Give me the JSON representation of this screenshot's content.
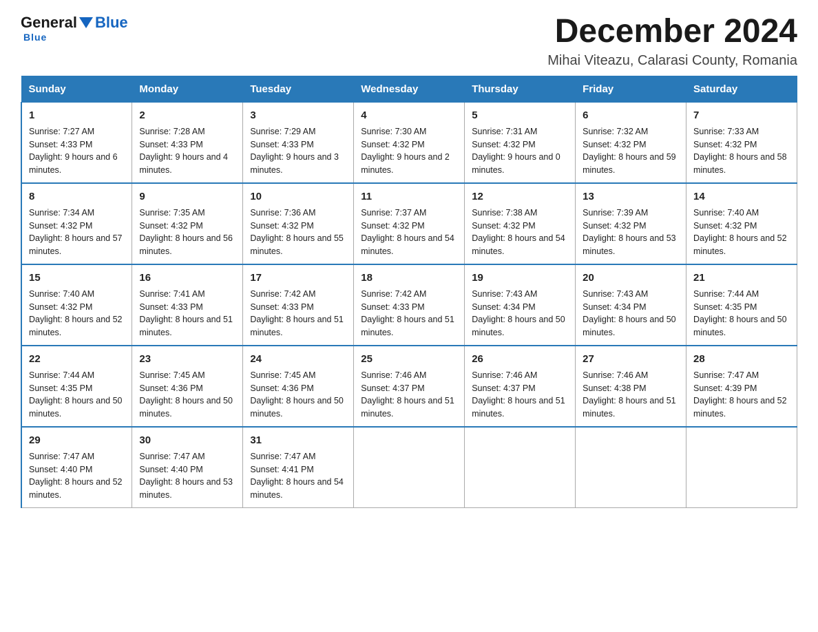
{
  "logo": {
    "general": "General",
    "blue": "Blue",
    "tagline": "Blue"
  },
  "header": {
    "title": "December 2024",
    "subtitle": "Mihai Viteazu, Calarasi County, Romania"
  },
  "days_of_week": [
    "Sunday",
    "Monday",
    "Tuesday",
    "Wednesday",
    "Thursday",
    "Friday",
    "Saturday"
  ],
  "weeks": [
    [
      {
        "day": "1",
        "sunrise": "7:27 AM",
        "sunset": "4:33 PM",
        "daylight": "9 hours and 6 minutes."
      },
      {
        "day": "2",
        "sunrise": "7:28 AM",
        "sunset": "4:33 PM",
        "daylight": "9 hours and 4 minutes."
      },
      {
        "day": "3",
        "sunrise": "7:29 AM",
        "sunset": "4:33 PM",
        "daylight": "9 hours and 3 minutes."
      },
      {
        "day": "4",
        "sunrise": "7:30 AM",
        "sunset": "4:32 PM",
        "daylight": "9 hours and 2 minutes."
      },
      {
        "day": "5",
        "sunrise": "7:31 AM",
        "sunset": "4:32 PM",
        "daylight": "9 hours and 0 minutes."
      },
      {
        "day": "6",
        "sunrise": "7:32 AM",
        "sunset": "4:32 PM",
        "daylight": "8 hours and 59 minutes."
      },
      {
        "day": "7",
        "sunrise": "7:33 AM",
        "sunset": "4:32 PM",
        "daylight": "8 hours and 58 minutes."
      }
    ],
    [
      {
        "day": "8",
        "sunrise": "7:34 AM",
        "sunset": "4:32 PM",
        "daylight": "8 hours and 57 minutes."
      },
      {
        "day": "9",
        "sunrise": "7:35 AM",
        "sunset": "4:32 PM",
        "daylight": "8 hours and 56 minutes."
      },
      {
        "day": "10",
        "sunrise": "7:36 AM",
        "sunset": "4:32 PM",
        "daylight": "8 hours and 55 minutes."
      },
      {
        "day": "11",
        "sunrise": "7:37 AM",
        "sunset": "4:32 PM",
        "daylight": "8 hours and 54 minutes."
      },
      {
        "day": "12",
        "sunrise": "7:38 AM",
        "sunset": "4:32 PM",
        "daylight": "8 hours and 54 minutes."
      },
      {
        "day": "13",
        "sunrise": "7:39 AM",
        "sunset": "4:32 PM",
        "daylight": "8 hours and 53 minutes."
      },
      {
        "day": "14",
        "sunrise": "7:40 AM",
        "sunset": "4:32 PM",
        "daylight": "8 hours and 52 minutes."
      }
    ],
    [
      {
        "day": "15",
        "sunrise": "7:40 AM",
        "sunset": "4:32 PM",
        "daylight": "8 hours and 52 minutes."
      },
      {
        "day": "16",
        "sunrise": "7:41 AM",
        "sunset": "4:33 PM",
        "daylight": "8 hours and 51 minutes."
      },
      {
        "day": "17",
        "sunrise": "7:42 AM",
        "sunset": "4:33 PM",
        "daylight": "8 hours and 51 minutes."
      },
      {
        "day": "18",
        "sunrise": "7:42 AM",
        "sunset": "4:33 PM",
        "daylight": "8 hours and 51 minutes."
      },
      {
        "day": "19",
        "sunrise": "7:43 AM",
        "sunset": "4:34 PM",
        "daylight": "8 hours and 50 minutes."
      },
      {
        "day": "20",
        "sunrise": "7:43 AM",
        "sunset": "4:34 PM",
        "daylight": "8 hours and 50 minutes."
      },
      {
        "day": "21",
        "sunrise": "7:44 AM",
        "sunset": "4:35 PM",
        "daylight": "8 hours and 50 minutes."
      }
    ],
    [
      {
        "day": "22",
        "sunrise": "7:44 AM",
        "sunset": "4:35 PM",
        "daylight": "8 hours and 50 minutes."
      },
      {
        "day": "23",
        "sunrise": "7:45 AM",
        "sunset": "4:36 PM",
        "daylight": "8 hours and 50 minutes."
      },
      {
        "day": "24",
        "sunrise": "7:45 AM",
        "sunset": "4:36 PM",
        "daylight": "8 hours and 50 minutes."
      },
      {
        "day": "25",
        "sunrise": "7:46 AM",
        "sunset": "4:37 PM",
        "daylight": "8 hours and 51 minutes."
      },
      {
        "day": "26",
        "sunrise": "7:46 AM",
        "sunset": "4:37 PM",
        "daylight": "8 hours and 51 minutes."
      },
      {
        "day": "27",
        "sunrise": "7:46 AM",
        "sunset": "4:38 PM",
        "daylight": "8 hours and 51 minutes."
      },
      {
        "day": "28",
        "sunrise": "7:47 AM",
        "sunset": "4:39 PM",
        "daylight": "8 hours and 52 minutes."
      }
    ],
    [
      {
        "day": "29",
        "sunrise": "7:47 AM",
        "sunset": "4:40 PM",
        "daylight": "8 hours and 52 minutes."
      },
      {
        "day": "30",
        "sunrise": "7:47 AM",
        "sunset": "4:40 PM",
        "daylight": "8 hours and 53 minutes."
      },
      {
        "day": "31",
        "sunrise": "7:47 AM",
        "sunset": "4:41 PM",
        "daylight": "8 hours and 54 minutes."
      },
      null,
      null,
      null,
      null
    ]
  ]
}
